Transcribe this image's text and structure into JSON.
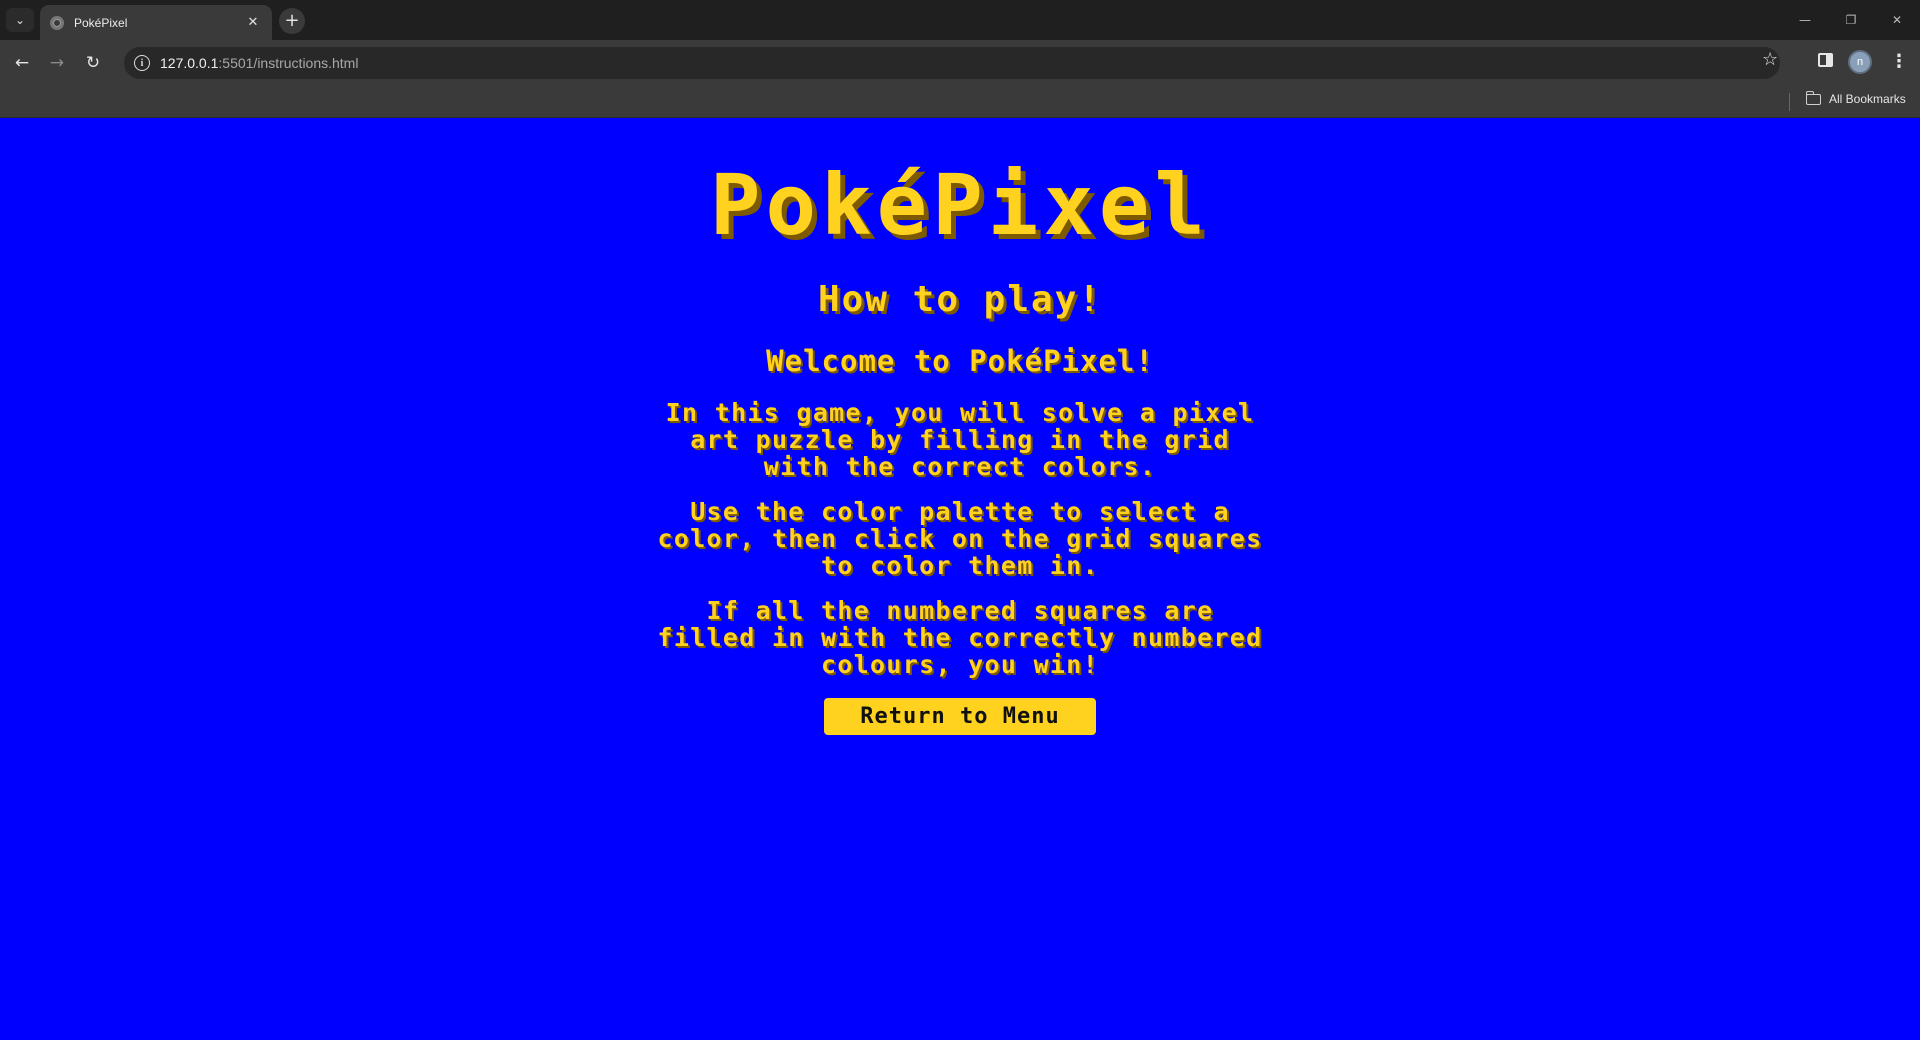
{
  "browser": {
    "tab_title": "PokéPixel",
    "new_tab_symbol": "+",
    "url_host": "127.0.0.1",
    "url_path": ":5501/instructions.html",
    "bookmarks_label": "All Bookmarks",
    "avatar_letter": "n"
  },
  "page": {
    "logo": "PokéPixel",
    "subtitle": "How to play!",
    "welcome": "Welcome to PokéPixel!",
    "paragraphs": [
      "In this game, you will solve a pixel art puzzle by filling in the grid with the correct colors.",
      "Use the color palette to select a color, then click on the grid squares to color them in.",
      "If all the numbered squares are filled in with the correctly numbered colours, you win!"
    ],
    "return_button": "Return to Menu"
  },
  "colors": {
    "background": "#0000ff",
    "text": "#ffd21f",
    "shadow": "#7d5a00",
    "button_bg": "#ffd21f"
  }
}
